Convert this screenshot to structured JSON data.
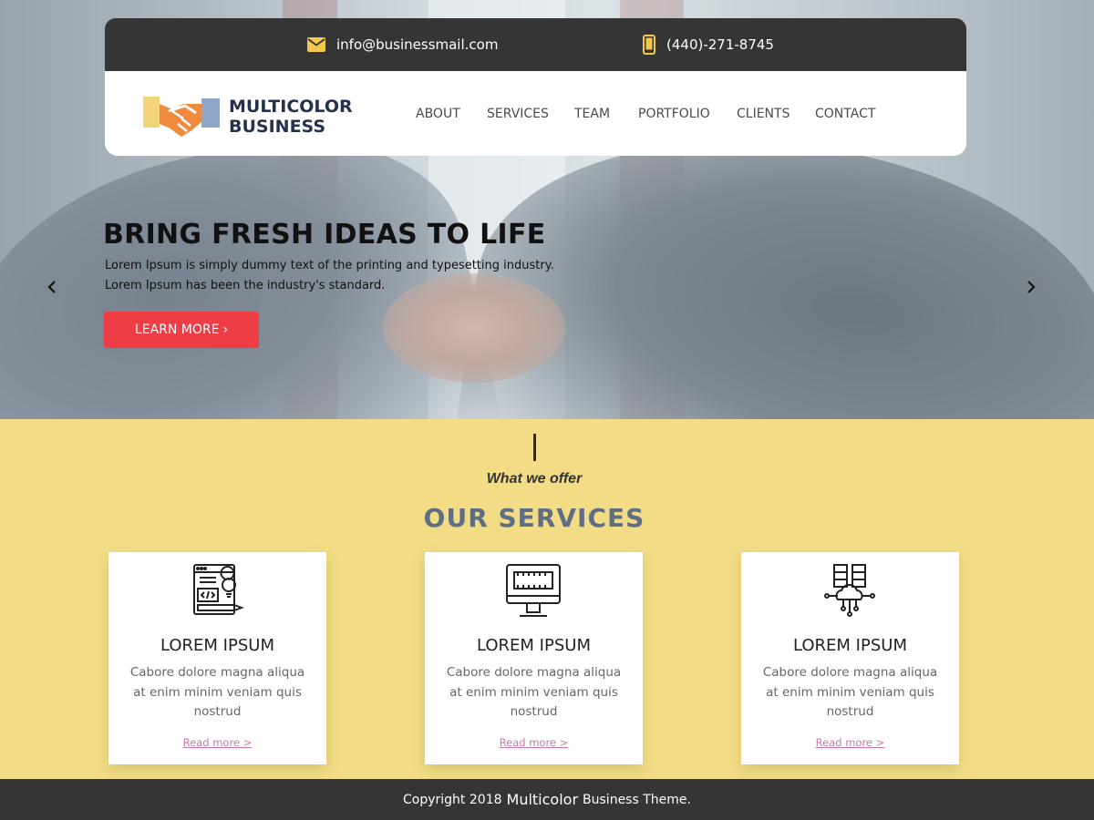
{
  "topbar": {
    "email": "info@businessmail.com",
    "email_icon": "mail-icon",
    "phone": "(440)-271-8745",
    "phone_icon": "phone-icon"
  },
  "logo": {
    "line1": "MULTICOLOR",
    "line2": "BUSINESS",
    "icon": "handshake-icon"
  },
  "nav": {
    "items": [
      "ABOUT",
      "SERVICES",
      "TEAM",
      "PORTFOLIO",
      "CLIENTS",
      "CONTACT"
    ]
  },
  "hero": {
    "title": "BRING FRESH IDEAS TO LIFE",
    "text_line1": "Lorem Ipsum is simply dummy text of the printing and typesetting industry.",
    "text_line2": "Lorem Ipsum has been the industry's standard.",
    "button_label": "LEARN MORE",
    "button_chevron": "›",
    "prev_icon": "chevron-left-icon",
    "next_icon": "chevron-right-icon"
  },
  "services": {
    "subtitle": "What we offer",
    "title": "OUR SERVICES",
    "cards": [
      {
        "icon": "web-development-icon",
        "title": "LOREM IPSUM",
        "text": "Cabore dolore magna aliqua at enim minim veniam quis nostrud",
        "link": "Read more >"
      },
      {
        "icon": "monitor-icon",
        "title": "LOREM IPSUM",
        "text": "Cabore dolore magna aliqua at enim minim veniam quis nostrud",
        "link": "Read more >"
      },
      {
        "icon": "cloud-server-icon",
        "title": "LOREM IPSUM",
        "text": "Cabore dolore magna aliqua at enim minim veniam quis nostrud",
        "link": "Read more >"
      }
    ]
  },
  "footer": {
    "prefix": "Copyright 2018",
    "brand": "Multicolor",
    "suffix": "Business Theme."
  },
  "colors": {
    "dark_bar": "#353535",
    "section_bg": "#f2dd86",
    "button_red": "#ef3d45",
    "logo_navy": "#26314d",
    "services_title": "#5f6d85",
    "read_more": "#c67aa8",
    "icon_yellow": "#f2c94c"
  }
}
